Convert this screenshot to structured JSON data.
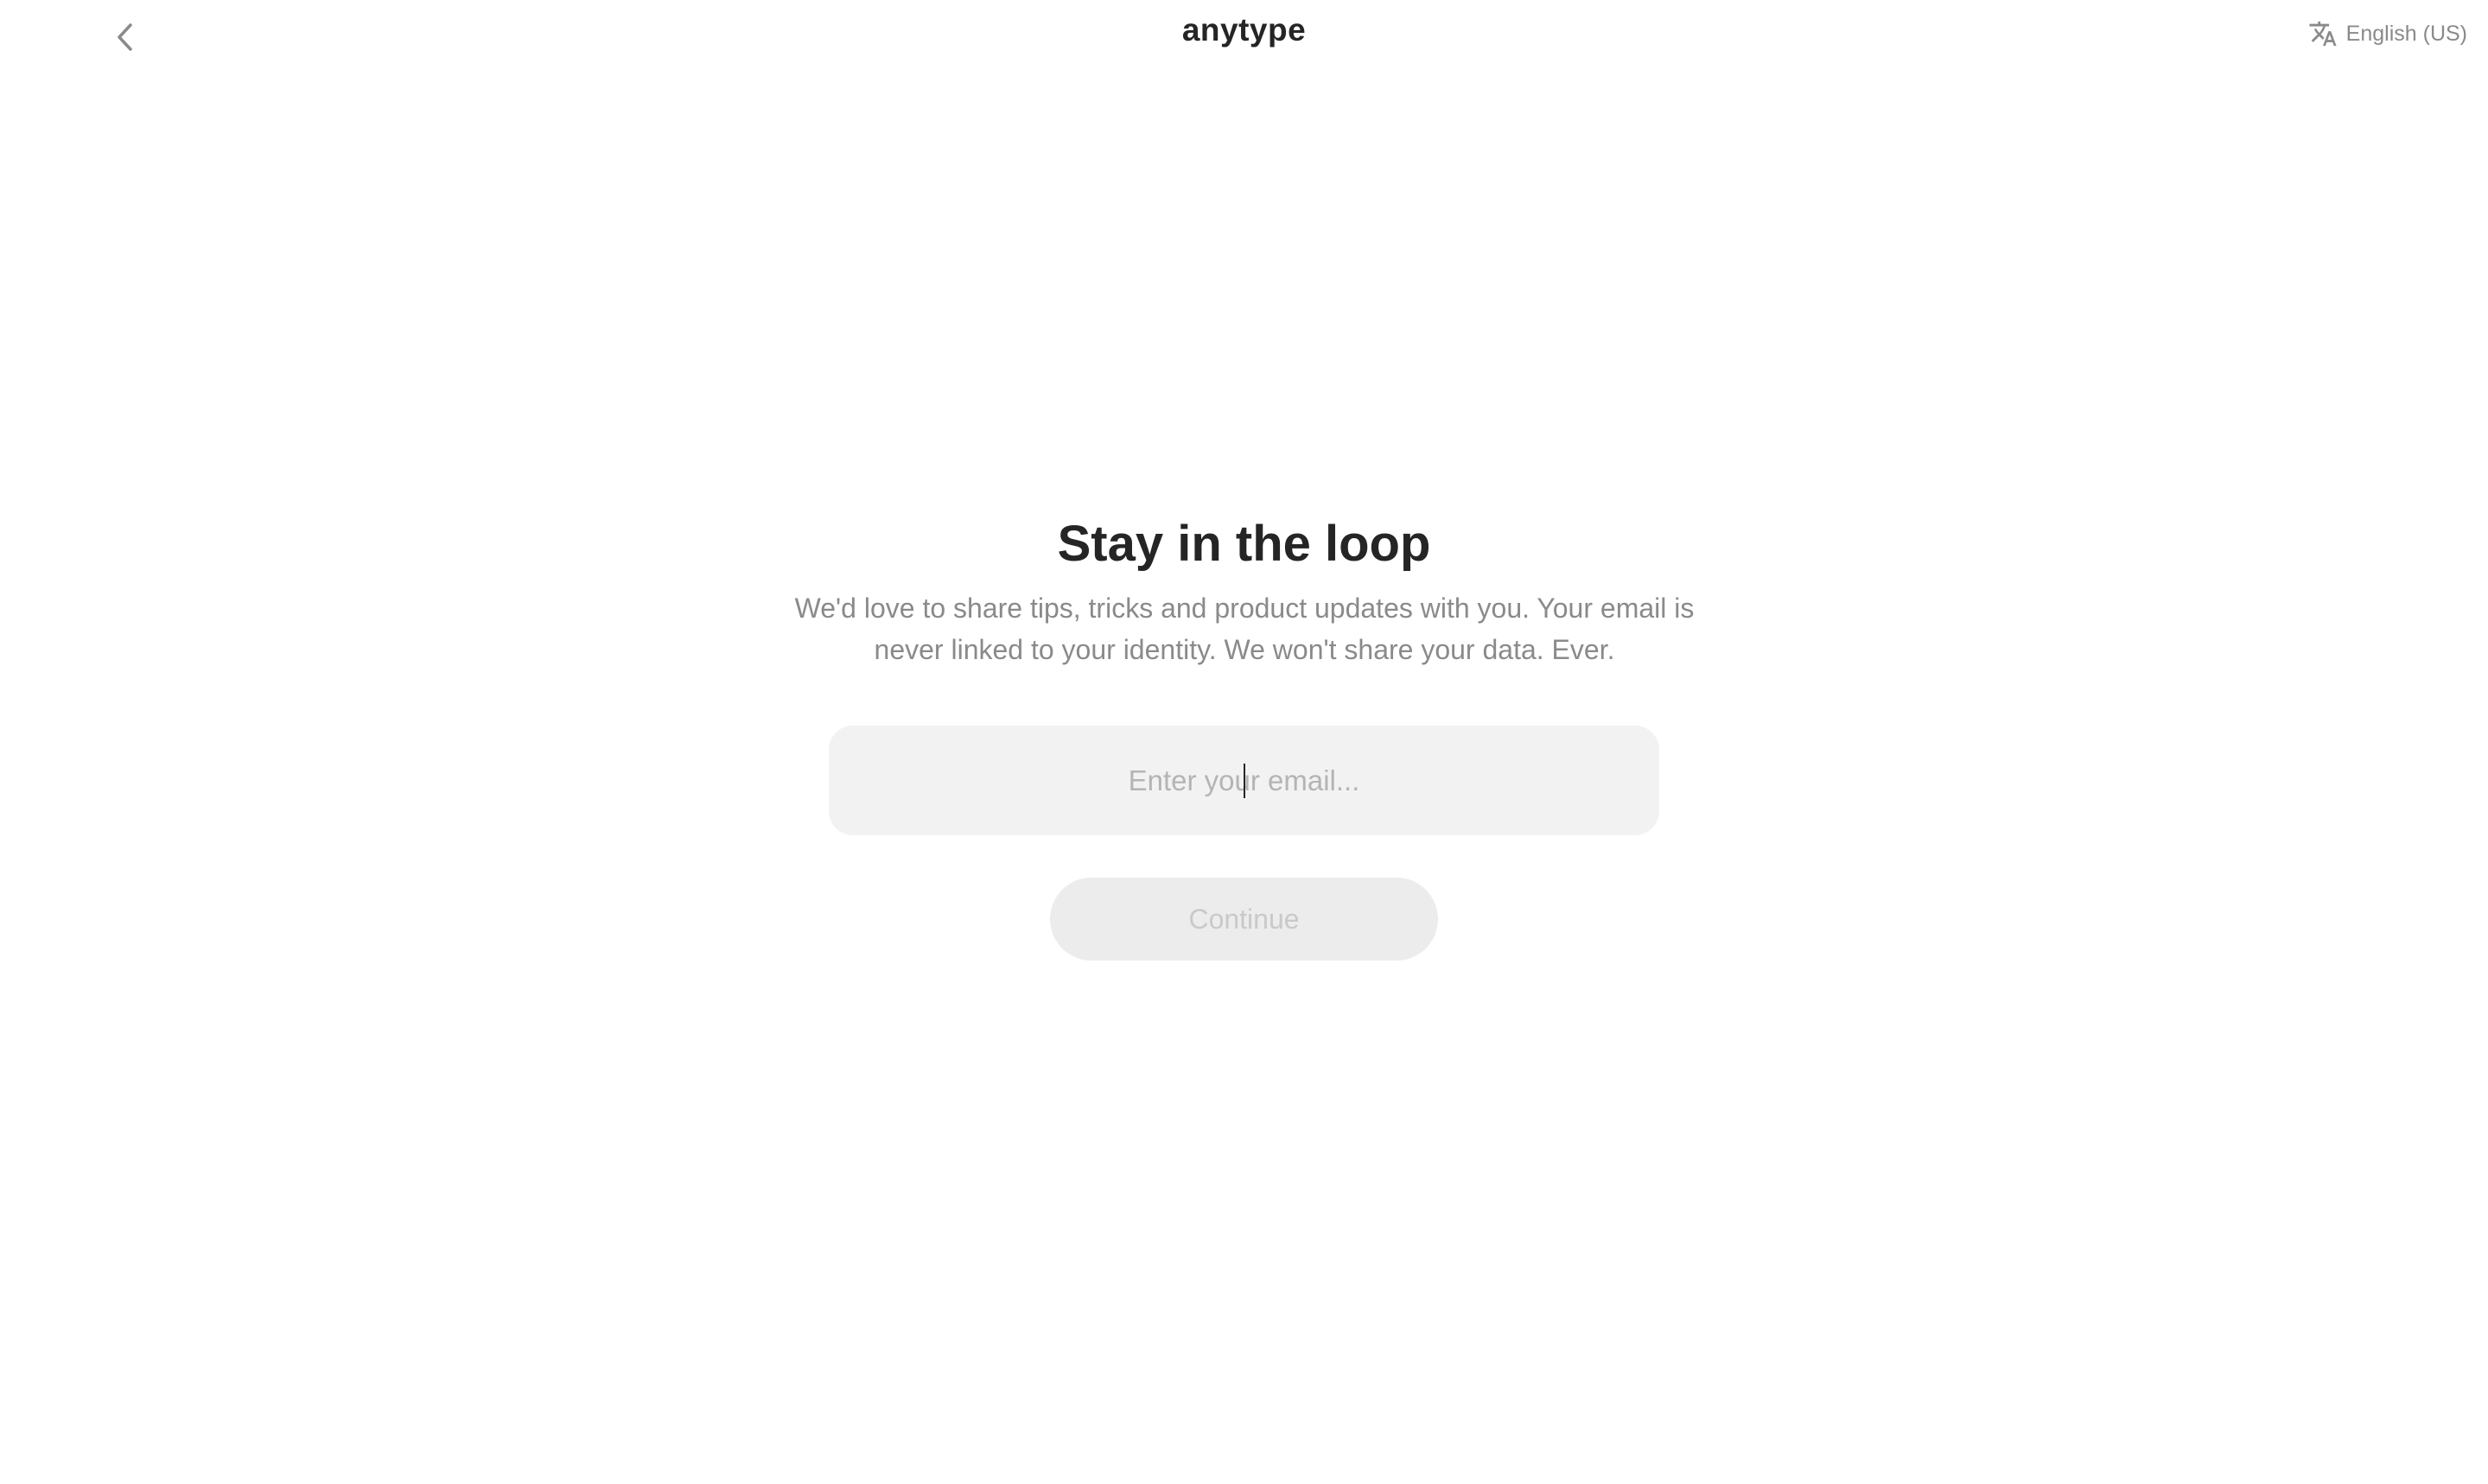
{
  "header": {
    "logo_text": "anytype",
    "language_label": "English (US)",
    "back_icon": "chevron-left-icon",
    "language_icon": "translate-icon"
  },
  "main": {
    "title": "Stay in the loop",
    "description": "We'd love to share tips, tricks and product updates with you. Your email is never linked to your identity. We won't share your data. Ever.",
    "email_placeholder": "Enter your email...",
    "email_value": "",
    "continue_label": "Continue"
  },
  "colors": {
    "text_primary": "#252525",
    "text_secondary": "#8a8a8a",
    "input_bg": "#f2f2f2",
    "button_disabled_bg": "#ececec",
    "button_disabled_text": "#c9c9c9"
  }
}
